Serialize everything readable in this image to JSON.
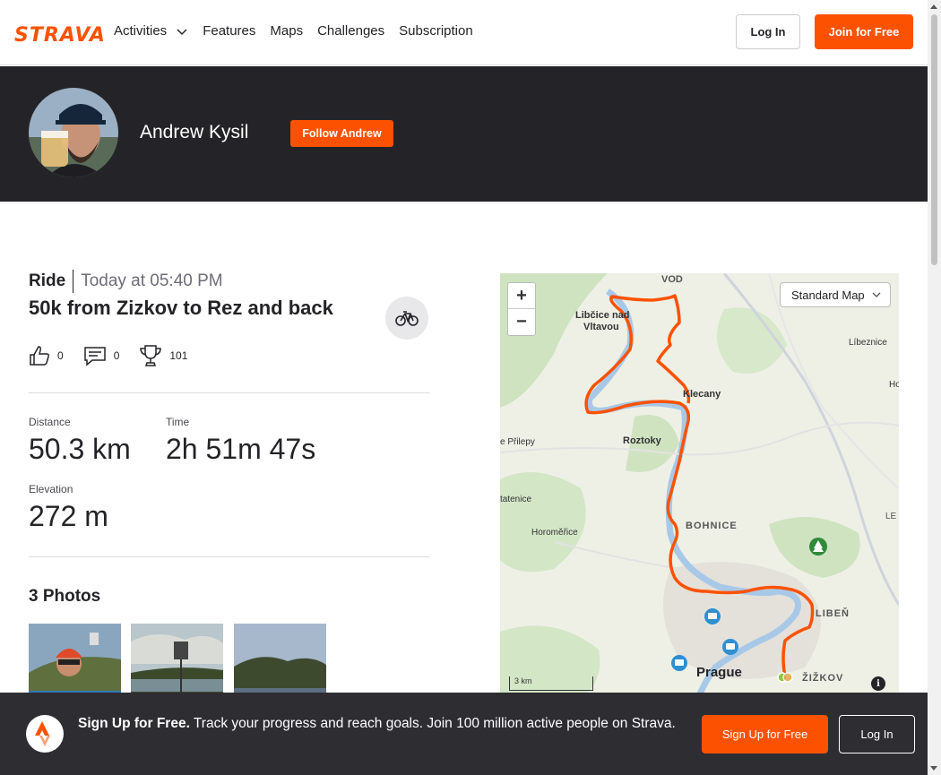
{
  "nav": {
    "logo": "STRAVA",
    "links": [
      "Activities",
      "Features",
      "Maps",
      "Challenges",
      "Subscription"
    ],
    "login": "Log In",
    "join": "Join for Free"
  },
  "athlete": {
    "name": "Andrew Kysil",
    "follow": "Follow Andrew"
  },
  "activity": {
    "type": "Ride",
    "time": "Today at 05:40 PM",
    "title": "50k from Zizkov to Rez and back",
    "kudos": "0",
    "comments": "0",
    "achievements": "101",
    "stats": [
      {
        "label": "Distance",
        "value": "50.3 km"
      },
      {
        "label": "Time",
        "value": "2h 51m 47s"
      },
      {
        "label": "Elevation",
        "value": "272 m"
      }
    ]
  },
  "photos": {
    "heading": "3 Photos"
  },
  "map": {
    "style": "Standard Map",
    "zoom_in": "+",
    "zoom_out": "−",
    "scale": "3 km",
    "info": "i",
    "labels": [
      "VOD",
      "Libčice nad",
      "Vltavou",
      "Líbeznice",
      "Ho",
      "Klecany",
      "Roztoky",
      "e Přilepy",
      "tatenice",
      "BOHNICE",
      "LE",
      "Horoměřice",
      "LIBEŇ",
      "Prague",
      "ŽIŽKOV"
    ]
  },
  "cta": {
    "bold": "Sign Up for Free.",
    "text": " Track your progress and reach goals. Join 100 million active people on Strava.",
    "signup": "Sign Up for Free",
    "login": "Log In"
  },
  "colors": {
    "brand": "#fc5200",
    "banner": "#242428",
    "cta_bg": "#2d2d32"
  }
}
